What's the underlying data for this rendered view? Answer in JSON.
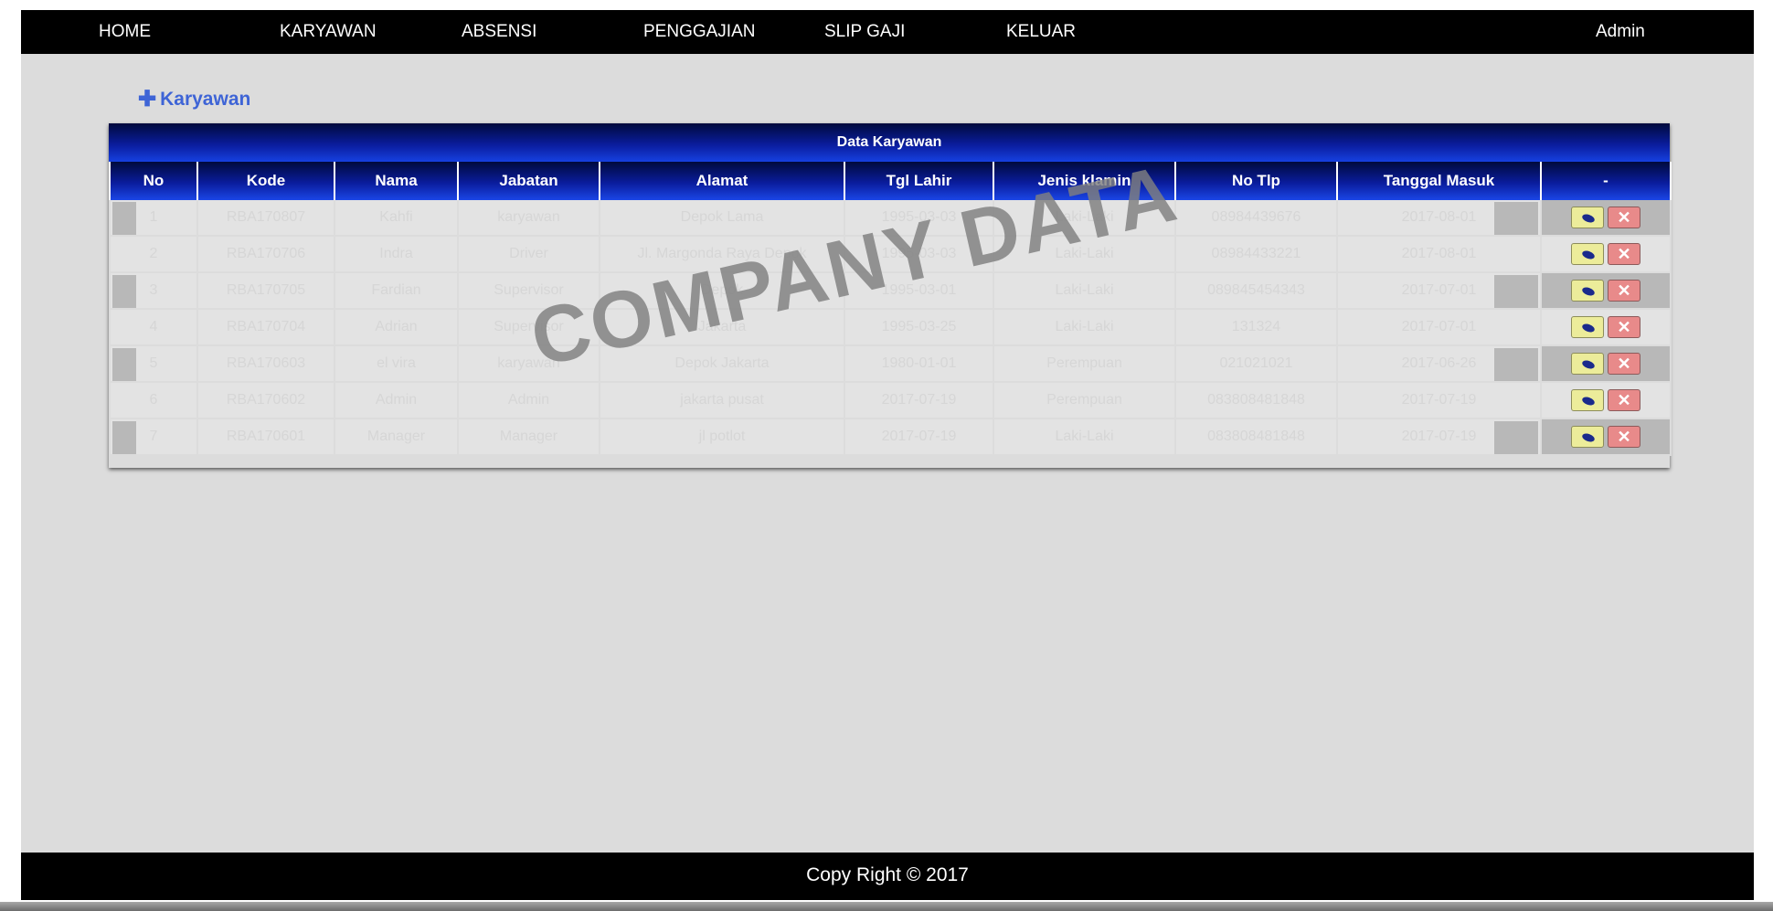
{
  "nav": {
    "items": [
      {
        "label": "HOME"
      },
      {
        "label": "KARYAWAN"
      },
      {
        "label": "ABSENSI"
      },
      {
        "label": "PENGGAJIAN"
      },
      {
        "label": "SLIP GAJI"
      },
      {
        "label": "KELUAR"
      }
    ],
    "user": "Admin"
  },
  "add_button": {
    "icon": "plus-icon",
    "label": "Karyawan"
  },
  "table": {
    "title": "Data Karyawan",
    "columns": [
      "No",
      "Kode",
      "Nama",
      "Jabatan",
      "Alamat",
      "Tgl Lahir",
      "Jenis klamin",
      "No Tlp",
      "Tanggal Masuk",
      "-"
    ],
    "rows": [
      [
        "1",
        "RBA170807",
        "Kahfi",
        "karyawan",
        "Depok Lama",
        "1995-03-03",
        "Laki-Laki",
        "08984439676",
        "2017-08-01"
      ],
      [
        "2",
        "RBA170706",
        "Indra",
        "Driver",
        "Jl. Margonda Raya Depok",
        "1995-03-03",
        "Laki-Laki",
        "08984433221",
        "2017-08-01"
      ],
      [
        "3",
        "RBA170705",
        "Fardian",
        "Supervisor",
        "Depok",
        "1995-03-01",
        "Laki-Laki",
        "089845454343",
        "2017-07-01"
      ],
      [
        "4",
        "RBA170704",
        "Adrian",
        "Supervisor",
        "Jakarta",
        "1995-03-25",
        "Laki-Laki",
        "131324",
        "2017-07-01"
      ],
      [
        "5",
        "RBA170603",
        "el vira",
        "karyawan",
        "Depok Jakarta",
        "1980-01-01",
        "Perempuan",
        "021021021",
        "2017-06-26"
      ],
      [
        "6",
        "RBA170602",
        "Admin",
        "Admin",
        "jakarta pusat",
        "2017-07-19",
        "Perempuan",
        "083808481848",
        "2017-07-19"
      ],
      [
        "7",
        "RBA170601",
        "Manager",
        "Manager",
        "jl potlot",
        "2017-07-19",
        "Laki-Laki",
        "083808481848",
        "2017-07-19"
      ]
    ],
    "edit_icon": "pencil-icon",
    "delete_label": "✕"
  },
  "watermark": "COMPANY DATA",
  "footer": {
    "text": "Copy Right © 2017"
  }
}
